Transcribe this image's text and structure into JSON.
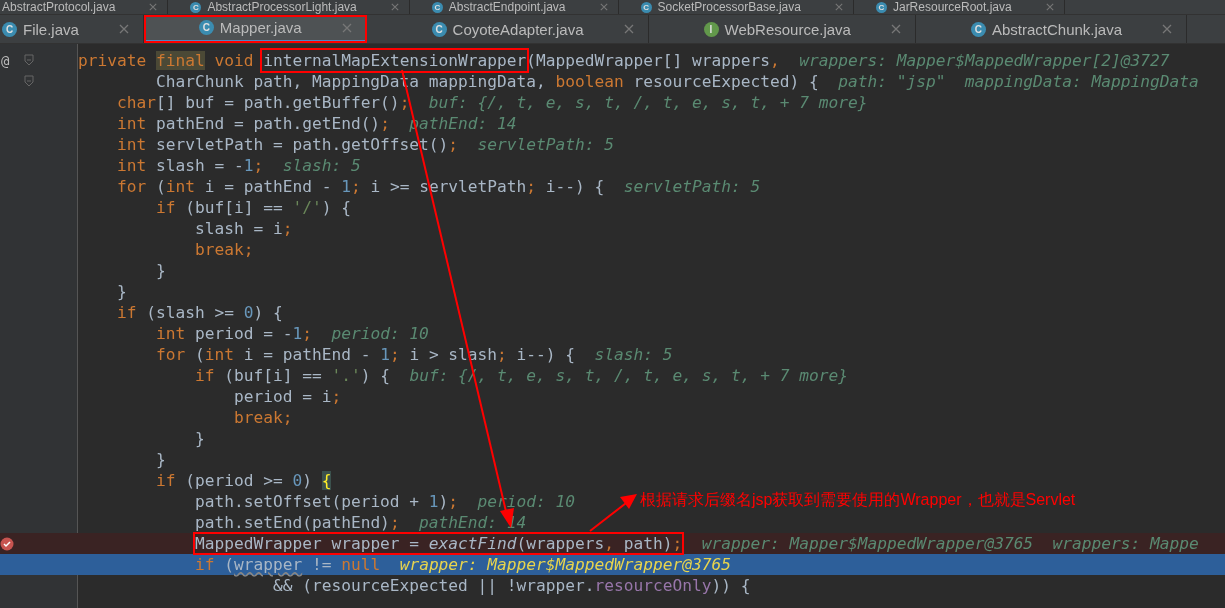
{
  "tab_rows": [
    {
      "tabs": [
        {
          "label": "AbstractProtocol.java",
          "selected": false,
          "annotated": false
        },
        {
          "label": "AbstractProcessorLight.java",
          "icon": "C",
          "selected": false,
          "annotated": false
        },
        {
          "label": "AbstractEndpoint.java",
          "icon": "C",
          "selected": false,
          "annotated": false
        },
        {
          "label": "SocketProcessorBase.java",
          "icon": "C",
          "selected": false,
          "annotated": false
        },
        {
          "label": "JarResourceRoot.java",
          "icon": "C",
          "selected": false,
          "annotated": false
        }
      ]
    },
    {
      "tabs": [
        {
          "label": "File.java",
          "icon": "C",
          "selected": false,
          "annotated": false
        },
        {
          "label": "Mapper.java",
          "icon": "C",
          "selected": true,
          "annotated": true
        },
        {
          "label": "CoyoteAdapter.java",
          "icon": "C",
          "selected": false,
          "annotated": false
        },
        {
          "label": "WebResource.java",
          "icon": "I",
          "selected": false,
          "annotated": false
        },
        {
          "label": "AbstractChunk.java",
          "icon": "C",
          "selected": false,
          "annotated": false
        }
      ]
    }
  ],
  "code_lines": [
    {
      "kind": "normal",
      "gutter_mark": "@",
      "fold": true,
      "boxed": false,
      "tokens": [
        {
          "kind": "kw",
          "text": "private "
        },
        {
          "kind": "marked",
          "text": "final"
        },
        {
          "kind": "kw",
          "text": " void "
        },
        {
          "kind": "boxed",
          "text": "internalMapExtensionWrapper"
        },
        {
          "kind": "plain",
          "text": "(MappedWrapper[] wrappers"
        },
        {
          "kind": "kw",
          "text": ","
        }
      ],
      "hints": [
        "wrappers: Mapper$MappedWrapper[2]@3727"
      ]
    },
    {
      "kind": "normal",
      "fold": true,
      "boxed": false,
      "tokens": [
        {
          "kind": "plain",
          "text": "        CharChunk path, MappingData mappingData, "
        },
        {
          "kind": "kw",
          "text": "boolean "
        },
        {
          "kind": "plain",
          "text": "resourceExpected) {"
        }
      ],
      "hints": [
        "path: \"jsp\"",
        "mappingData: MappingData"
      ]
    },
    {
      "kind": "normal",
      "fold": false,
      "boxed": false,
      "tokens": [
        {
          "kind": "kw",
          "text": "    char"
        },
        {
          "kind": "plain",
          "text": "[] buf = path.getBuffer()"
        },
        {
          "kind": "kw",
          "text": ";"
        }
      ],
      "hints": [
        "buf: {/, t, e, s, t, /, t, e, s, t, + 7 more}"
      ]
    },
    {
      "kind": "normal",
      "fold": false,
      "boxed": false,
      "tokens": [
        {
          "kind": "kw",
          "text": "    int "
        },
        {
          "kind": "plain",
          "text": "pathEnd = path.getEnd()"
        },
        {
          "kind": "kw",
          "text": ";"
        }
      ],
      "hints": [
        "pathEnd: 14"
      ]
    },
    {
      "kind": "normal",
      "fold": false,
      "boxed": false,
      "tokens": [
        {
          "kind": "kw",
          "text": "    int "
        },
        {
          "kind": "plain",
          "text": "servletPath = path.getOffset()"
        },
        {
          "kind": "kw",
          "text": ";"
        }
      ],
      "hints": [
        "servletPath: 5"
      ]
    },
    {
      "kind": "normal",
      "fold": false,
      "boxed": false,
      "tokens": [
        {
          "kind": "kw",
          "text": "    int "
        },
        {
          "kind": "plain",
          "text": "slash = -"
        },
        {
          "kind": "num",
          "text": "1"
        },
        {
          "kind": "kw",
          "text": ";"
        }
      ],
      "hints": [
        "slash: 5"
      ]
    },
    {
      "kind": "normal",
      "fold": false,
      "boxed": false,
      "tokens": [
        {
          "kind": "kw",
          "text": "    for "
        },
        {
          "kind": "plain",
          "text": "("
        },
        {
          "kind": "kw",
          "text": "int "
        },
        {
          "kind": "plain",
          "text": "i = pathEnd - "
        },
        {
          "kind": "num",
          "text": "1"
        },
        {
          "kind": "kw",
          "text": "; "
        },
        {
          "kind": "plain",
          "text": "i >= servletPath"
        },
        {
          "kind": "kw",
          "text": "; "
        },
        {
          "kind": "plain",
          "text": "i--) {"
        }
      ],
      "hints": [
        "servletPath: 5"
      ]
    },
    {
      "kind": "normal",
      "fold": false,
      "boxed": false,
      "tokens": [
        {
          "kind": "kw",
          "text": "        if "
        },
        {
          "kind": "plain",
          "text": "(buf[i] == "
        },
        {
          "kind": "str",
          "text": "'/'"
        },
        {
          "kind": "plain",
          "text": ") {"
        }
      ]
    },
    {
      "kind": "normal",
      "fold": false,
      "boxed": false,
      "tokens": [
        {
          "kind": "plain",
          "text": "            slash = i"
        },
        {
          "kind": "kw",
          "text": ";"
        }
      ]
    },
    {
      "kind": "normal",
      "fold": false,
      "boxed": false,
      "tokens": [
        {
          "kind": "kw",
          "text": "            break;"
        }
      ]
    },
    {
      "kind": "normal",
      "fold": false,
      "boxed": false,
      "tokens": [
        {
          "kind": "plain",
          "text": "        }"
        }
      ]
    },
    {
      "kind": "normal",
      "fold": false,
      "boxed": false,
      "tokens": [
        {
          "kind": "plain",
          "text": "    }"
        }
      ]
    },
    {
      "kind": "normal",
      "fold": false,
      "boxed": false,
      "tokens": [
        {
          "kind": "kw",
          "text": "    if "
        },
        {
          "kind": "plain",
          "text": "(slash >= "
        },
        {
          "kind": "num",
          "text": "0"
        },
        {
          "kind": "plain",
          "text": ") {"
        }
      ]
    },
    {
      "kind": "normal",
      "fold": false,
      "boxed": false,
      "tokens": [
        {
          "kind": "kw",
          "text": "        int "
        },
        {
          "kind": "plain",
          "text": "period = -"
        },
        {
          "kind": "num",
          "text": "1"
        },
        {
          "kind": "kw",
          "text": ";"
        }
      ],
      "hints": [
        "period: 10"
      ]
    },
    {
      "kind": "normal",
      "fold": false,
      "boxed": false,
      "tokens": [
        {
          "kind": "kw",
          "text": "        for "
        },
        {
          "kind": "plain",
          "text": "("
        },
        {
          "kind": "kw",
          "text": "int "
        },
        {
          "kind": "plain",
          "text": "i = pathEnd - "
        },
        {
          "kind": "num",
          "text": "1"
        },
        {
          "kind": "kw",
          "text": "; "
        },
        {
          "kind": "plain",
          "text": "i > slash"
        },
        {
          "kind": "kw",
          "text": "; "
        },
        {
          "kind": "plain",
          "text": "i--) {"
        }
      ],
      "hints": [
        "slash: 5"
      ]
    },
    {
      "kind": "normal",
      "fold": false,
      "boxed": false,
      "tokens": [
        {
          "kind": "kw",
          "text": "            if "
        },
        {
          "kind": "plain",
          "text": "(buf[i] == "
        },
        {
          "kind": "str",
          "text": "'.'"
        },
        {
          "kind": "plain",
          "text": ") {"
        }
      ],
      "hints": [
        "buf: {/, t, e, s, t, /, t, e, s, t, + 7 more}"
      ]
    },
    {
      "kind": "normal",
      "fold": false,
      "boxed": false,
      "tokens": [
        {
          "kind": "plain",
          "text": "                period = i"
        },
        {
          "kind": "kw",
          "text": ";"
        }
      ]
    },
    {
      "kind": "normal",
      "fold": false,
      "boxed": false,
      "tokens": [
        {
          "kind": "kw",
          "text": "                break;"
        }
      ]
    },
    {
      "kind": "normal",
      "fold": false,
      "boxed": false,
      "tokens": [
        {
          "kind": "plain",
          "text": "            }"
        }
      ]
    },
    {
      "kind": "normal",
      "fold": false,
      "boxed": false,
      "tokens": [
        {
          "kind": "plain",
          "text": "        }"
        }
      ]
    },
    {
      "kind": "normal",
      "fold": false,
      "boxed": false,
      "tokens": [
        {
          "kind": "kw",
          "text": "        if "
        },
        {
          "kind": "plain",
          "text": "(period >= "
        },
        {
          "kind": "num",
          "text": "0"
        },
        {
          "kind": "plain",
          "text": ") "
        },
        {
          "kind": "brace",
          "text": "{"
        }
      ]
    },
    {
      "kind": "normal",
      "fold": false,
      "boxed": false,
      "tokens": [
        {
          "kind": "plain",
          "text": "            path.setOffset(period + "
        },
        {
          "kind": "num",
          "text": "1"
        },
        {
          "kind": "plain",
          "text": ")"
        },
        {
          "kind": "kw",
          "text": ";"
        }
      ],
      "hints": [
        "period: 10"
      ]
    },
    {
      "kind": "normal",
      "fold": false,
      "boxed": false,
      "tokens": [
        {
          "kind": "plain",
          "text": "            path.setEnd(pathEnd)"
        },
        {
          "kind": "kw",
          "text": ";"
        }
      ],
      "hints": [
        "pathEnd: 14"
      ]
    },
    {
      "kind": "breakpoint",
      "fold": false,
      "boxed": true,
      "tokens": [
        {
          "kind": "plain",
          "text": "            MappedWrapper wrapper = "
        },
        {
          "kind": "static",
          "text": "exactFind"
        },
        {
          "kind": "plain",
          "text": "(wrappers"
        },
        {
          "kind": "kw",
          "text": ", "
        },
        {
          "kind": "plain",
          "text": "path)"
        },
        {
          "kind": "kw",
          "text": ";"
        }
      ],
      "hints": [
        "wrapper: Mapper$MappedWrapper@3765",
        "wrappers: Mappe"
      ]
    },
    {
      "kind": "current",
      "fold": false,
      "boxed": false,
      "tokens": [
        {
          "kind": "kw",
          "text": "            if "
        },
        {
          "kind": "plain",
          "text": "("
        },
        {
          "kind": "squiggle",
          "text": "wrapper"
        },
        {
          "kind": "plain",
          "text": " != "
        },
        {
          "kind": "kw",
          "text": "null"
        }
      ],
      "hints": [
        "wrapper: Mapper$MappedWrapper@3765"
      ]
    },
    {
      "kind": "normal",
      "fold": false,
      "boxed": false,
      "tokens": [
        {
          "kind": "plain",
          "text": "                    && (resourceExpected || !wrapper."
        },
        {
          "kind": "field",
          "text": "resourceOnly"
        },
        {
          "kind": "plain",
          "text": ")) {"
        }
      ]
    }
  ],
  "annotation": {
    "text": "根据请求后缀名jsp获取到需要使用的Wrapper，也就是Servlet"
  }
}
